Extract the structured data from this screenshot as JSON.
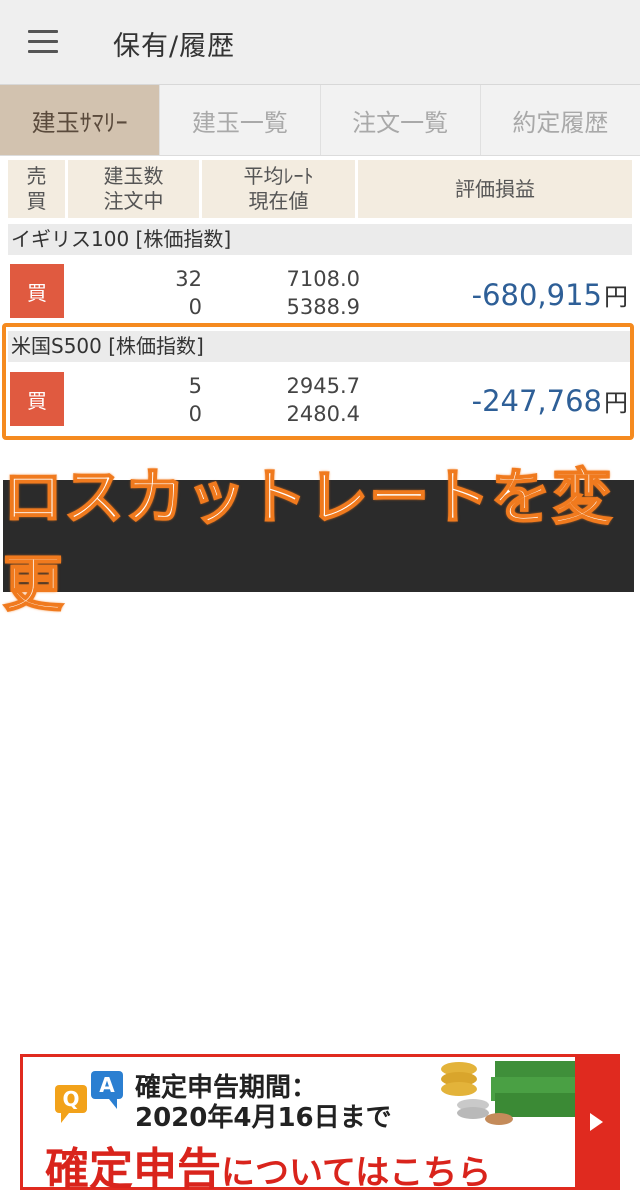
{
  "header": {
    "title": "保有/履歴",
    "menu_icon": "hamburger-menu-icon"
  },
  "tabs": [
    {
      "label": "建玉ｻﾏﾘｰ",
      "active": true
    },
    {
      "label": "建玉一覧",
      "active": false
    },
    {
      "label": "注文一覧",
      "active": false
    },
    {
      "label": "約定履歴",
      "active": false
    }
  ],
  "columns": {
    "side": [
      "売",
      "買"
    ],
    "position": [
      "建玉数",
      "注文中"
    ],
    "rate": [
      "平均ﾚｰﾄ",
      "現在値"
    ],
    "pl": "評価損益"
  },
  "instruments": [
    {
      "name": "イギリス100 [株価指数]",
      "side": "買",
      "position_qty": "32",
      "order_qty": "0",
      "avg_rate": "7108.0",
      "current_rate": "5388.9",
      "pl": "-680,915",
      "currency": "円"
    },
    {
      "name": "米国S500 [株価指数]",
      "side": "買",
      "position_qty": "5",
      "order_qty": "0",
      "avg_rate": "2945.7",
      "current_rate": "2480.4",
      "pl": "-247,768",
      "currency": "円"
    }
  ],
  "caption": "ロスカットレートを変更",
  "ad": {
    "line1": "確定申告期間：",
    "line2": "2020年4月16日まで",
    "line3_big": "確定申告",
    "line3_small": "についてはこちら"
  },
  "colors": {
    "accent_tab": "#d2c2af",
    "buy": "#e05a40",
    "loss": "#2e5f97",
    "highlight": "#f58a1f",
    "ad_red": "#e02a1f"
  }
}
